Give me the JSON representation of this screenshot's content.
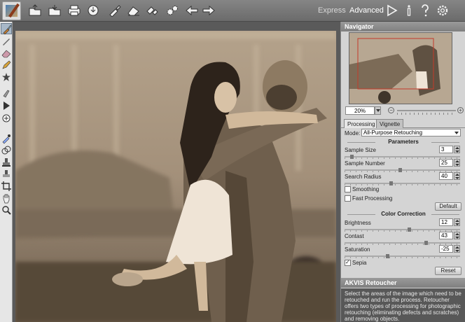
{
  "toolbar": {
    "icons": [
      "logo-icon",
      "open-icon",
      "save-icon",
      "print-icon",
      "share-icon",
      "brush-icon",
      "eraser-icon",
      "batch-icon",
      "settings-gears-icon",
      "back-arrow-icon",
      "forward-arrow-icon"
    ],
    "modes": {
      "express": "Express",
      "advanced": "Advanced"
    },
    "right_icons": [
      "run-icon",
      "info-icon",
      "help-icon",
      "preferences-icon"
    ]
  },
  "tools": [
    "retouch-brush-icon",
    "chisel-icon",
    "eraser-icon",
    "pencil-icon",
    "star-icon",
    "tube-icon",
    "run-icon",
    "healing-icon",
    "pipette-icon",
    "clone-icon",
    "stamp-icon",
    "crop-icon",
    "hand-icon",
    "zoom-icon"
  ],
  "navigator": {
    "title": "Navigator",
    "zoom": "20%"
  },
  "tabs": {
    "processing": "Processing",
    "vignette": "Vignette"
  },
  "processing": {
    "mode_label": "Mode:",
    "mode_value": "All-Purpose Retouching",
    "parameters_title": "Parameters",
    "sample_size": {
      "label": "Sample Size",
      "value": "3",
      "fraction": 0.05
    },
    "sample_number": {
      "label": "Sample Number",
      "value": "25",
      "fraction": 0.48
    },
    "search_radius": {
      "label": "Search Radius",
      "value": "40",
      "fraction": 0.4
    },
    "smoothing": {
      "label": "Smoothing",
      "checked": false
    },
    "fast_processing": {
      "label": "Fast Processing",
      "checked": false
    },
    "default_btn": "Default",
    "color_title": "Color Correction",
    "brightness": {
      "label": "Brightness",
      "value": "12",
      "fraction": 0.56
    },
    "contrast": {
      "label": "Contast",
      "value": "43",
      "fraction": 0.71
    },
    "saturation": {
      "label": "Saturation",
      "value": "-25",
      "fraction": 0.37
    },
    "sepia": {
      "label": "Sepia",
      "checked": true
    },
    "reset_btn": "Reset"
  },
  "help": {
    "title": "AKVIS Retoucher",
    "text": "Select the areas of the image which need to be retouched and run the process. Retoucher offers two types of processing for photographic retouching (eliminating defects and scratches) and removing objects."
  }
}
